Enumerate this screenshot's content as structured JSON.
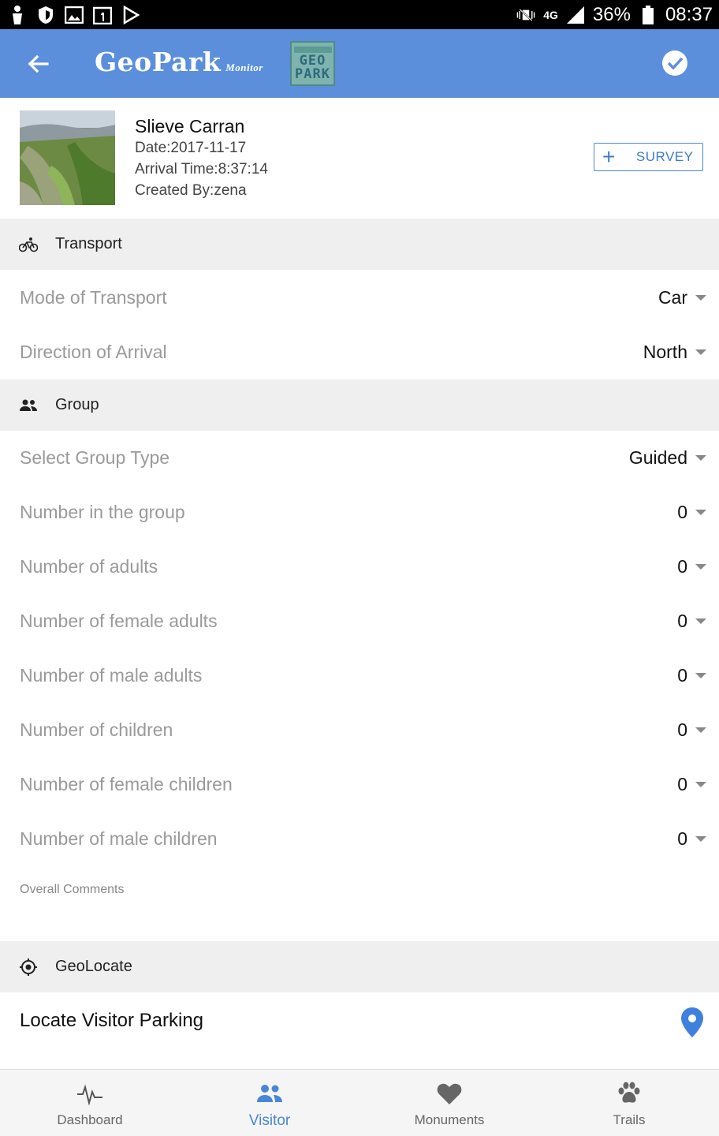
{
  "status_bar": {
    "network": "4G",
    "battery": "36%",
    "time": "08:37"
  },
  "app_bar": {
    "brand_main": "GeoPark",
    "brand_sub": "Monitor",
    "logo_text_1": "GEO",
    "logo_text_2": "PARK",
    "back_icon": "arrow-left-icon",
    "confirm_icon": "check-circle-icon",
    "colors": {
      "primary": "#5b8fdb",
      "accent": "#4a86d8"
    }
  },
  "site": {
    "name": "Slieve Carran",
    "date": "Date:2017-11-17",
    "arrival": "Arrival Time:8:37:14",
    "created_by": "Created By:zena",
    "survey_button": "SURVEY"
  },
  "transport": {
    "title": "Transport",
    "icon": "bicycle-icon",
    "rows": [
      {
        "label": "Mode of Transport",
        "value": "Car"
      },
      {
        "label": "Direction of Arrival",
        "value": "North"
      }
    ]
  },
  "group": {
    "title": "Group",
    "icon": "people-icon",
    "rows": [
      {
        "label": "Select Group Type",
        "value": "Guided"
      },
      {
        "label": "Number in the group",
        "value": "0"
      },
      {
        "label": "Number of adults",
        "value": "0"
      },
      {
        "label": "Number of female adults",
        "value": "0"
      },
      {
        "label": "Number of male adults",
        "value": "0"
      },
      {
        "label": "Number of children",
        "value": "0"
      },
      {
        "label": "Number of female children",
        "value": "0"
      },
      {
        "label": "Number of male children",
        "value": "0"
      }
    ],
    "comments_placeholder": "Overall Comments"
  },
  "geolocate": {
    "title": "GeoLocate",
    "icon": "target-icon",
    "locate_label": "Locate Visitor Parking",
    "pin_icon": "map-pin-icon"
  },
  "bottom_nav": [
    {
      "label": "Dashboard",
      "icon": "pulse-icon",
      "active": false
    },
    {
      "label": "Visitor",
      "icon": "people-icon",
      "active": true
    },
    {
      "label": "Monuments",
      "icon": "heart-icon",
      "active": false
    },
    {
      "label": "Trails",
      "icon": "paw-icon",
      "active": false
    }
  ]
}
